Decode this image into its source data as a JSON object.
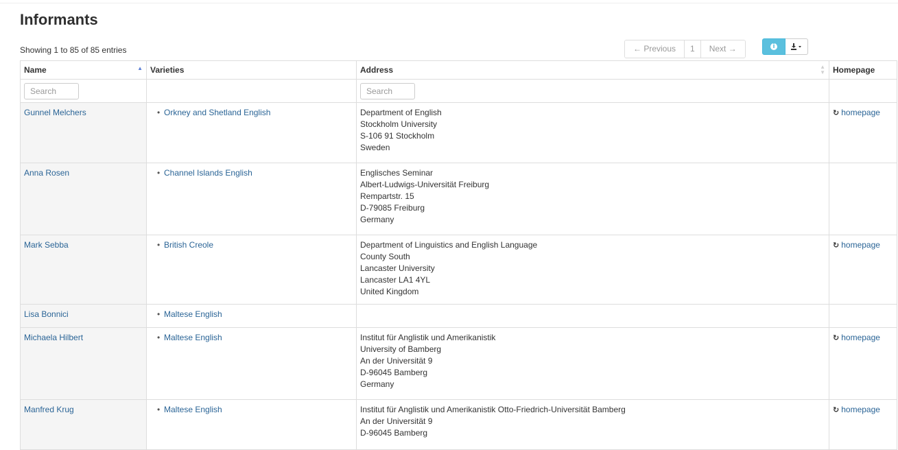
{
  "page": {
    "title": "Informants",
    "info": "Showing 1 to 85 of 85 entries"
  },
  "pagination": {
    "previous": "← Previous",
    "current": "1",
    "next": "Next →"
  },
  "toolbar": {
    "info_icon": "info-icon",
    "download_icon": "download-icon",
    "info_color": "#5bc0de"
  },
  "table": {
    "columns": [
      "Name",
      "Varieties",
      "Address",
      "Homepage"
    ],
    "search_placeholder": "Search",
    "homepage_label": "homepage",
    "rows": [
      {
        "name": "Gunnel Melchers",
        "variety": "Orkney and Shetland English",
        "address": [
          "Department of English",
          "Stockholm University",
          "S-106 91 Stockholm",
          "Sweden"
        ],
        "homepage": "homepage"
      },
      {
        "name": "Anna Rosen",
        "variety": "Channel Islands English",
        "address": [
          "Englisches Seminar",
          "Albert-Ludwigs-Universität Freiburg",
          "Rempartstr. 15",
          "D-79085 Freiburg",
          "Germany"
        ],
        "homepage": ""
      },
      {
        "name": "Mark Sebba",
        "variety": "British Creole",
        "address": [
          "Department of Linguistics and English Language",
          "County South",
          "Lancaster University",
          "Lancaster LA1 4YL",
          "United Kingdom"
        ],
        "homepage": "homepage"
      },
      {
        "name": "Lisa Bonnici",
        "variety": "Maltese English",
        "address": [],
        "homepage": ""
      },
      {
        "name": "Michaela Hilbert",
        "variety": "Maltese English",
        "address": [
          "Institut für Anglistik und Amerikanistik",
          "University of Bamberg",
          "An der Universität 9",
          "D-96045 Bamberg",
          "Germany"
        ],
        "homepage": "homepage"
      },
      {
        "name": "Manfred Krug",
        "variety": "Maltese English",
        "address": [
          "Institut für Anglistik und Amerikanistik Otto-Friedrich-Universität Bamberg",
          "An der Universität 9",
          "D-96045 Bamberg"
        ],
        "homepage": "homepage"
      }
    ]
  }
}
